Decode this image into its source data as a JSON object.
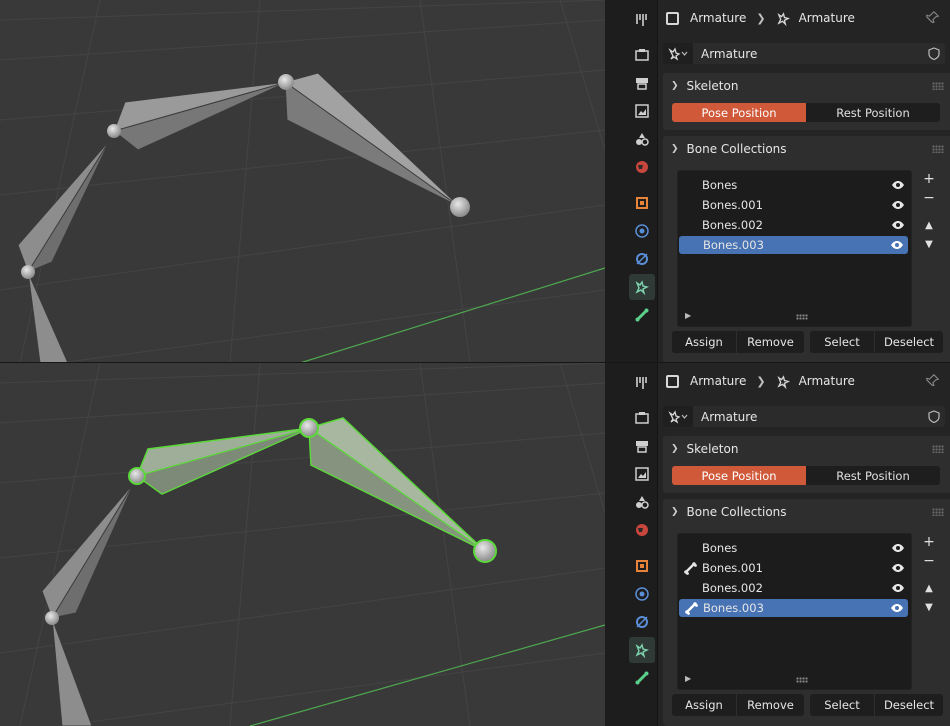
{
  "panels": [
    {
      "breadcrumb": {
        "object": "Armature",
        "data": "Armature"
      },
      "data_block_name": "Armature",
      "skeleton": {
        "title": "Skeleton",
        "pose_position": "Pose Position",
        "rest_position": "Rest Position"
      },
      "bone_collections": {
        "title": "Bone Collections",
        "items": [
          {
            "name": "Bones",
            "has_bone_icon": false,
            "selected": false
          },
          {
            "name": "Bones.001",
            "has_bone_icon": false,
            "selected": false
          },
          {
            "name": "Bones.002",
            "has_bone_icon": false,
            "selected": false
          },
          {
            "name": "Bones.003",
            "has_bone_icon": false,
            "selected": true
          }
        ],
        "buttons": {
          "assign": "Assign",
          "remove": "Remove",
          "select": "Select",
          "deselect": "Deselect"
        },
        "add": "+",
        "remove_sym": "−"
      }
    },
    {
      "breadcrumb": {
        "object": "Armature",
        "data": "Armature"
      },
      "data_block_name": "Armature",
      "skeleton": {
        "title": "Skeleton",
        "pose_position": "Pose Position",
        "rest_position": "Rest Position"
      },
      "bone_collections": {
        "title": "Bone Collections",
        "items": [
          {
            "name": "Bones",
            "has_bone_icon": false,
            "selected": false
          },
          {
            "name": "Bones.001",
            "has_bone_icon": true,
            "selected": false
          },
          {
            "name": "Bones.002",
            "has_bone_icon": false,
            "selected": false
          },
          {
            "name": "Bones.003",
            "has_bone_icon": true,
            "selected": true
          }
        ],
        "buttons": {
          "assign": "Assign",
          "remove": "Remove",
          "select": "Select",
          "deselect": "Deselect"
        },
        "add": "+",
        "remove_sym": "−"
      }
    }
  ],
  "colors": {
    "accent": "#d0593a",
    "selection": "#4772b3",
    "bone_highlight": "#5bd93a",
    "viewport_bg": "#393939"
  },
  "tab_icons": [
    "tool-icon",
    "render-icon",
    "output-icon",
    "view-layer-icon",
    "scene-icon",
    "world-icon",
    "object-icon",
    "modifier-icon",
    "physics-icon",
    "armature-data-icon",
    "bone-icon"
  ]
}
